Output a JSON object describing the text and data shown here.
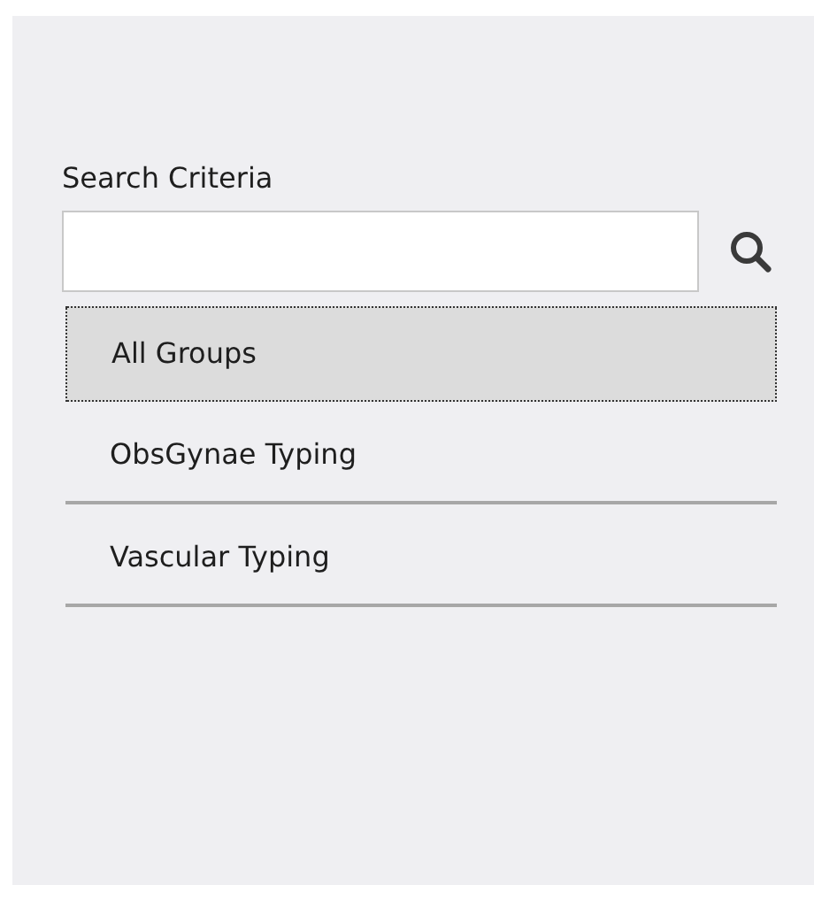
{
  "search": {
    "label": "Search Criteria"
  },
  "groups": [
    {
      "label": "All Groups",
      "selected": true
    },
    {
      "label": "ObsGynae Typing",
      "selected": false
    },
    {
      "label": "Vascular Typing",
      "selected": false
    }
  ]
}
